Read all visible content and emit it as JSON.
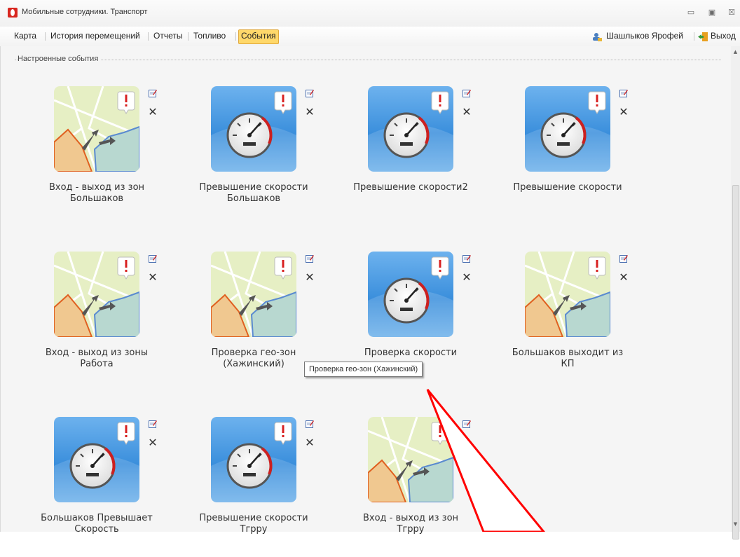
{
  "window": {
    "title": "Мобильные сотрудники. Транспорт",
    "controls": [
      "minimize-icon",
      "restore-icon",
      "close-icon"
    ]
  },
  "menu": {
    "items": [
      {
        "label": "Карта",
        "active": false
      },
      {
        "label": "История перемещений",
        "active": false
      },
      {
        "label": "Отчеты",
        "active": false
      },
      {
        "label": "Топливо",
        "active": false
      },
      {
        "label": "События",
        "active": true
      }
    ],
    "user": "Шашлыков Ярофей",
    "exit": "Выход"
  },
  "group": {
    "title": "Настроенные события"
  },
  "tiles": [
    {
      "type": "map",
      "label_line1": "Вход - выход из зон",
      "label_line2": "Большаков"
    },
    {
      "type": "speed",
      "label_line1": "Превышение скорости",
      "label_line2": "Большаков"
    },
    {
      "type": "speed",
      "label_line1": "Превышение скорости2",
      "label_line2": ""
    },
    {
      "type": "speed",
      "label_line1": "Превышение скорости",
      "label_line2": ""
    },
    {
      "type": "map",
      "label_line1": "Вход - выход из зоны",
      "label_line2": "Работа"
    },
    {
      "type": "map",
      "label_line1": "Проверка гео-зон",
      "label_line2": "(Хажинский)"
    },
    {
      "type": "speed",
      "label_line1": "Проверка скорости",
      "label_line2": ""
    },
    {
      "type": "map",
      "label_line1": "Большаков выходит из",
      "label_line2": "КП"
    },
    {
      "type": "speed",
      "label_line1": "Большаков Превышает",
      "label_line2": "Скорость"
    },
    {
      "type": "speed",
      "label_line1": "Превышение скорости",
      "label_line2": "Тгрру"
    },
    {
      "type": "map",
      "label_line1": "Вход - выход из зон",
      "label_line2": "Тгрру"
    }
  ],
  "tooltip": "Проверка гео-зон (Хажинский)",
  "colors": {
    "accent": "#ffd86a",
    "arrow_annotation": "#ff0000",
    "speed_bg": "#4a98e0",
    "map_bg": "#e8f0c6"
  }
}
